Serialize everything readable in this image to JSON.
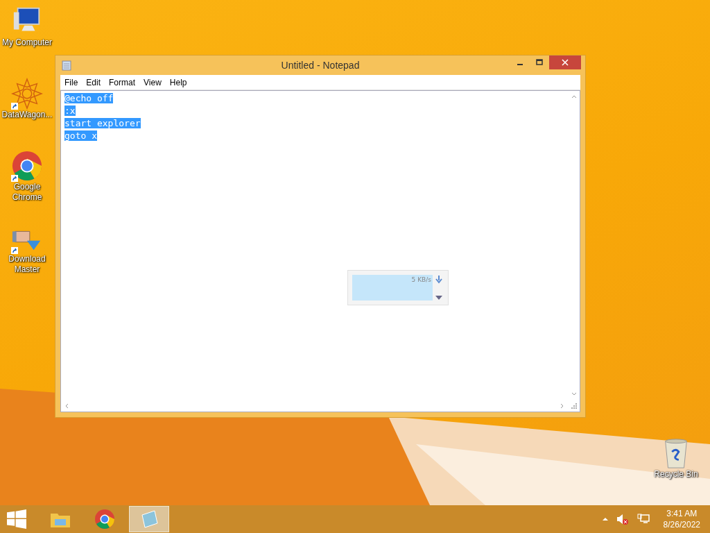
{
  "desktop_icons": [
    {
      "kind": "computer",
      "label": "My Computer",
      "shortcut": false
    },
    {
      "kind": "star",
      "label": "DataWagon...",
      "shortcut": true
    },
    {
      "kind": "chrome",
      "label": "Google Chrome",
      "shortcut": true
    },
    {
      "kind": "download",
      "label": "Download Master",
      "shortcut": true
    }
  ],
  "recycle_bin": {
    "label": "Recycle Bin"
  },
  "window": {
    "title": "Untitled - Notepad",
    "menu": [
      "File",
      "Edit",
      "Format",
      "View",
      "Help"
    ],
    "lines": [
      {
        "text": "@echo off",
        "selected": true
      },
      {
        "text": ":x",
        "selected": true
      },
      {
        "text": "start explorer",
        "selected": true
      },
      {
        "text": "goto x",
        "selected": true
      }
    ]
  },
  "download_widget": {
    "speed": "5 KB/s"
  },
  "taskbar": {
    "apps": [
      {
        "kind": "explorer",
        "selected": false
      },
      {
        "kind": "chrome",
        "selected": false
      },
      {
        "kind": "notepad",
        "selected": true
      }
    ],
    "time": "3:41 AM",
    "date": "8/26/2022"
  }
}
